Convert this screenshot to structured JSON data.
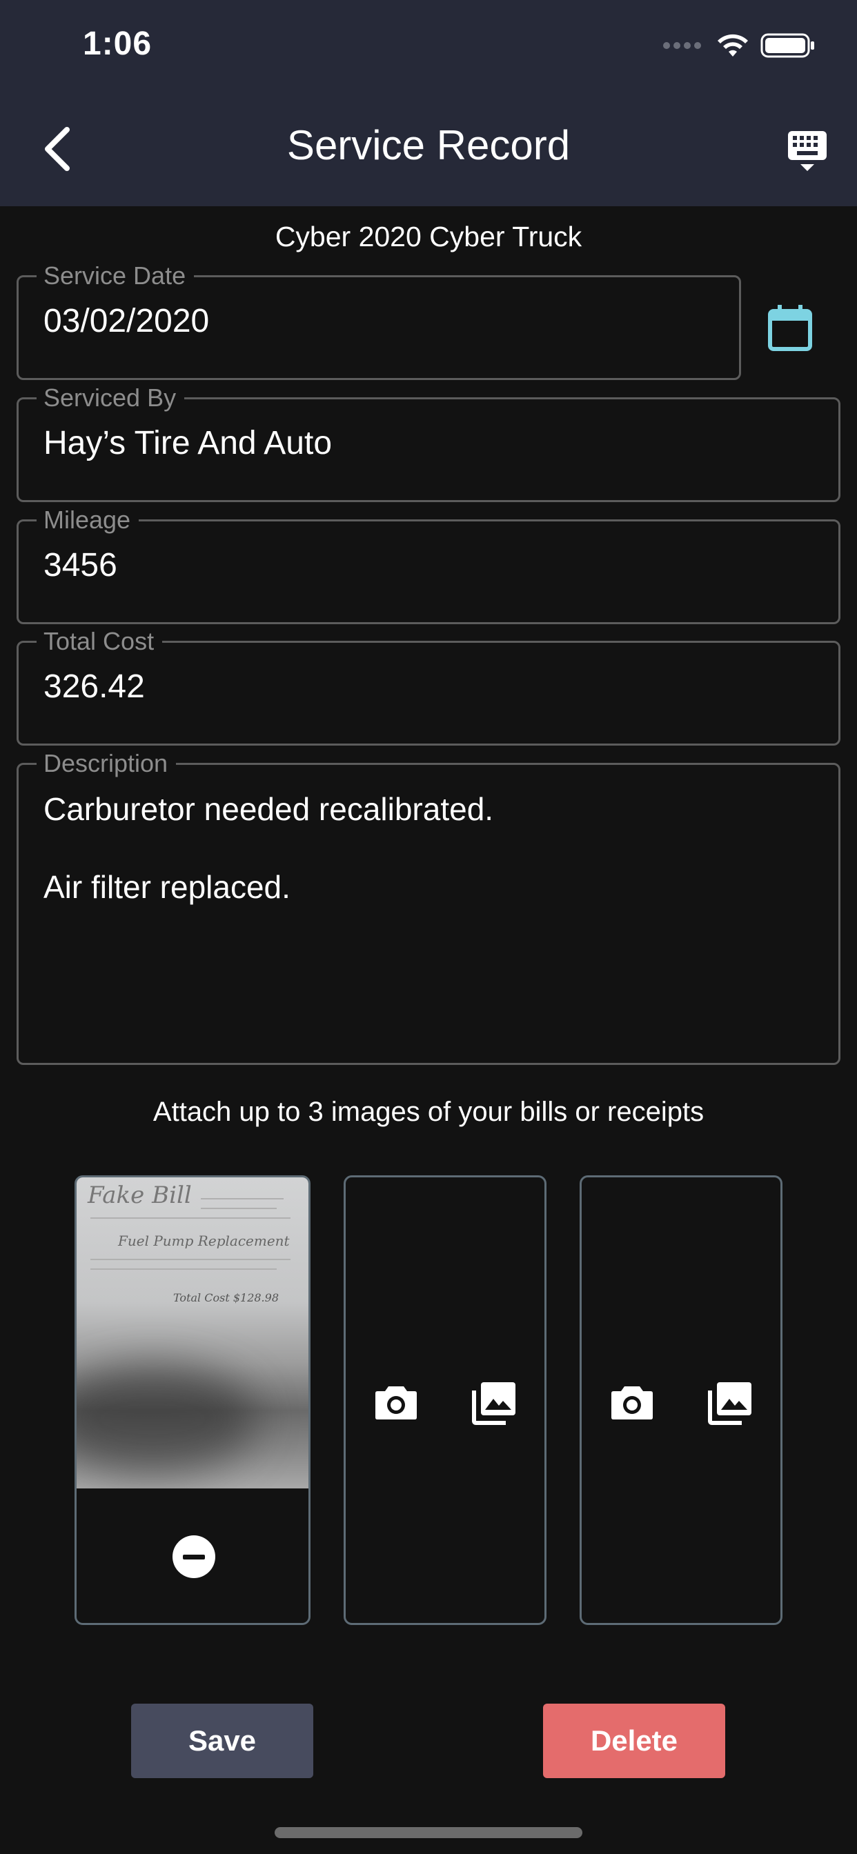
{
  "status_bar": {
    "time": "1:06"
  },
  "header": {
    "title": "Service Record"
  },
  "vehicle": "Cyber 2020 Cyber Truck",
  "form": {
    "service_date": {
      "label": "Service Date",
      "value": "03/02/2020"
    },
    "serviced_by": {
      "label": "Serviced By",
      "value": "Hay’s Tire And Auto"
    },
    "mileage": {
      "label": "Mileage",
      "value": "3456"
    },
    "total_cost": {
      "label": "Total Cost",
      "value": "326.42"
    },
    "description": {
      "label": "Description",
      "lines": [
        "Carburetor needed recalibrated.",
        "Air filter replaced."
      ]
    }
  },
  "attachments": {
    "prompt": "Attach up to 3 images of your bills or receipts",
    "receipt": {
      "title": "Fake Bill",
      "line": "Fuel Pump Replacement",
      "total": "Total Cost  $128.98"
    }
  },
  "actions": {
    "save": "Save",
    "delete": "Delete"
  },
  "colors": {
    "header_bg": "#262938",
    "accent": "#7dd3e2",
    "save_bg": "#474b5e",
    "delete_bg": "#e46c6c",
    "slot_border": "#5d6b75"
  },
  "icons": [
    "back-chevron-icon",
    "keyboard-icon",
    "calendar-icon",
    "camera-icon",
    "photo-library-icon",
    "remove-icon",
    "wifi-icon",
    "battery-icon"
  ]
}
